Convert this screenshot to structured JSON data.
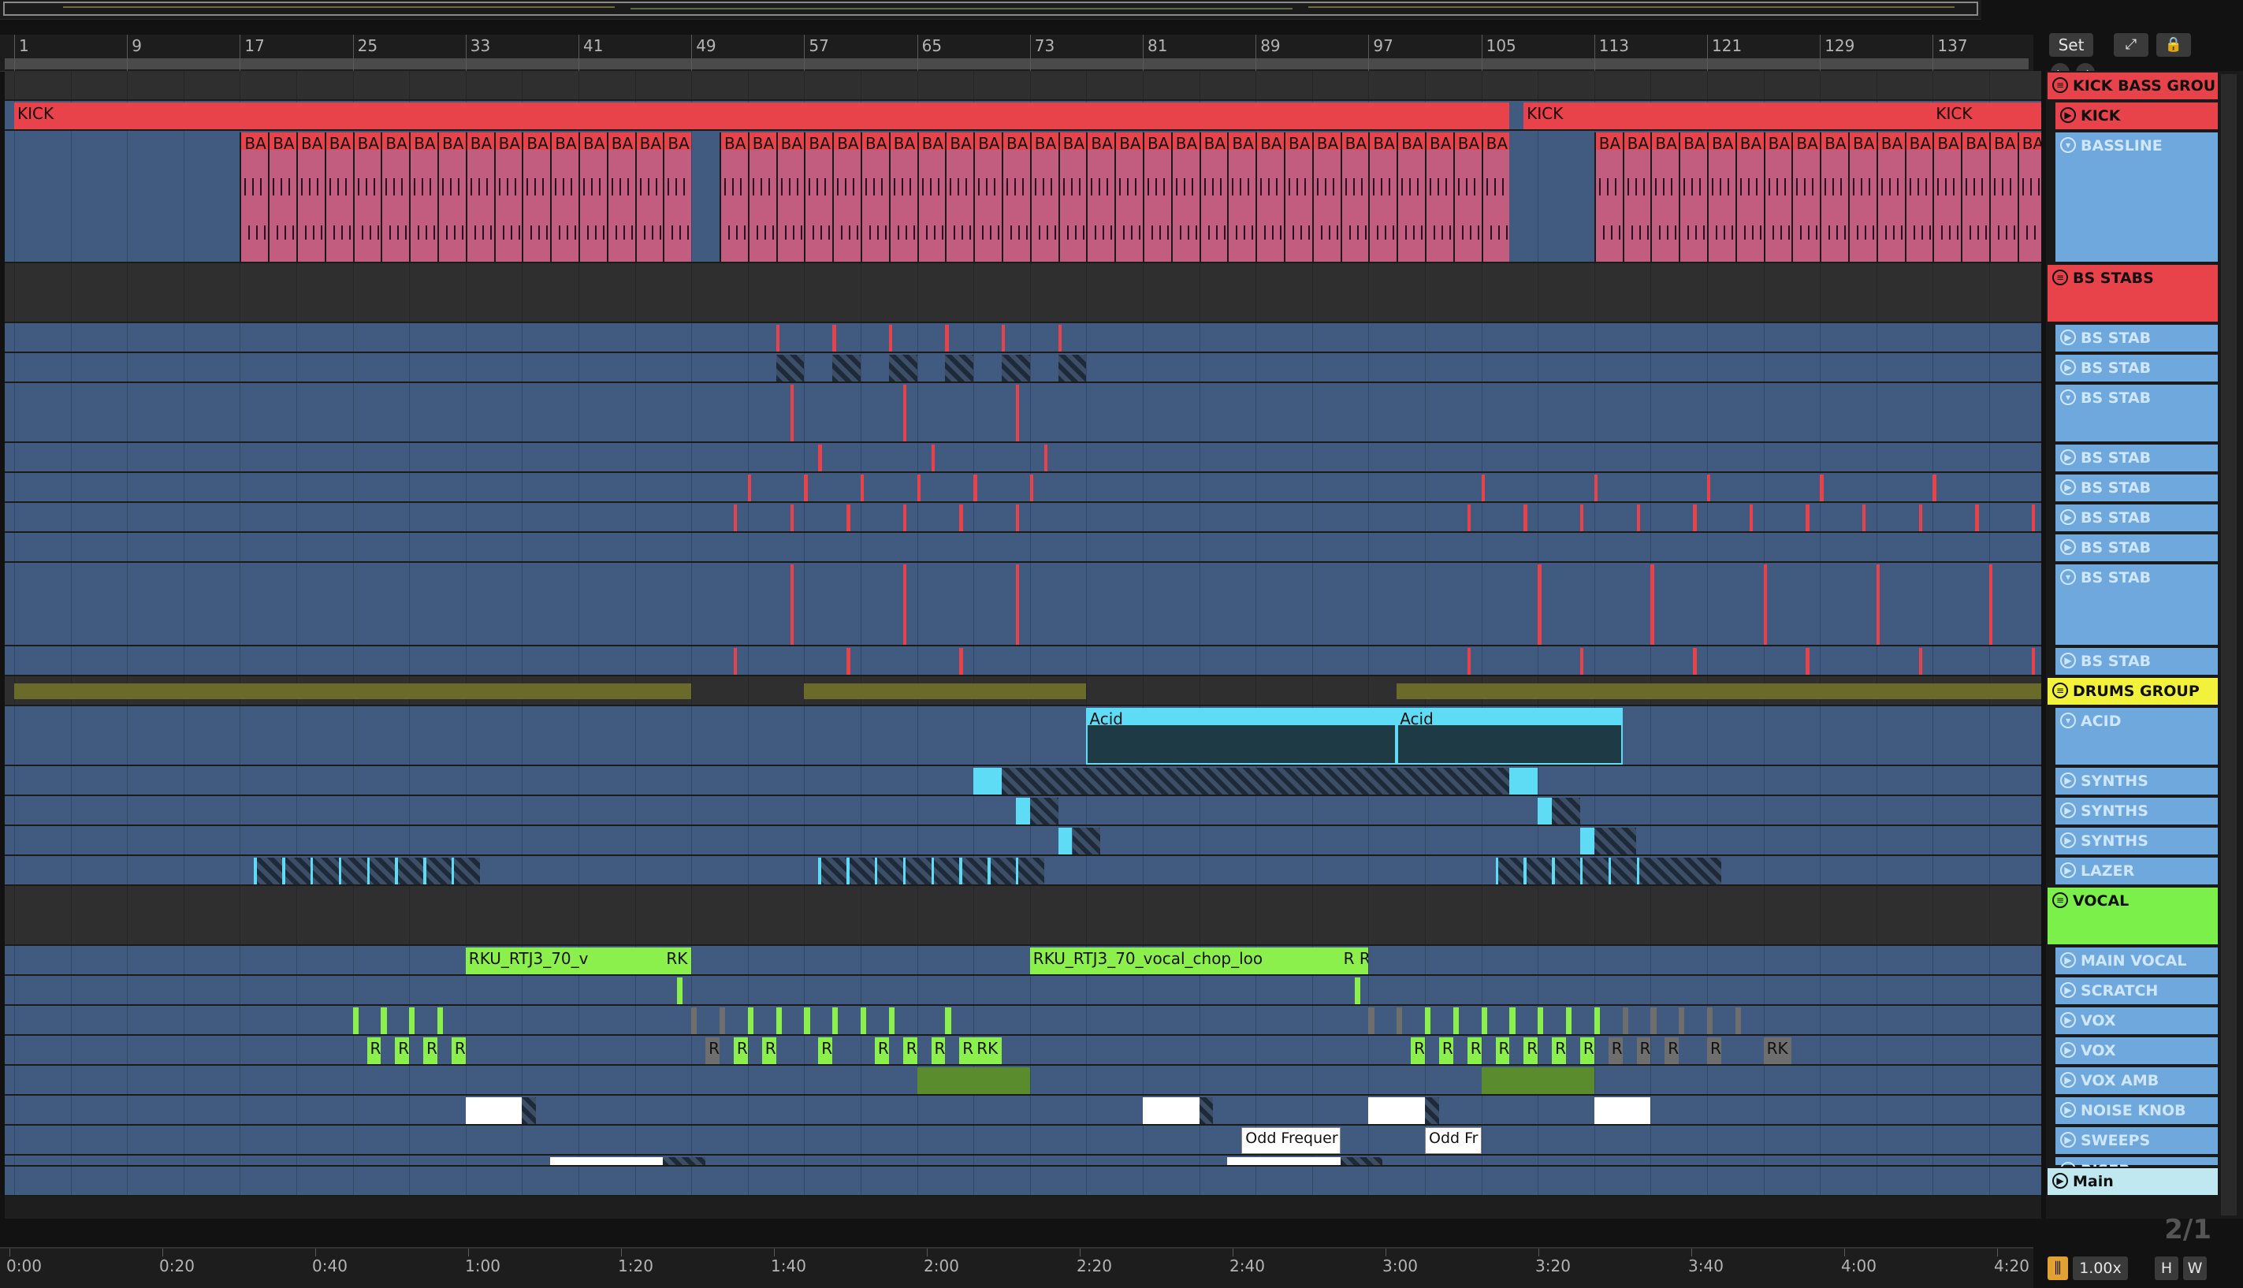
{
  "app": {
    "set_label": "Set",
    "zoom_label": "2/1"
  },
  "bar_ruler": [
    "1",
    "9",
    "17",
    "25",
    "33",
    "41",
    "49",
    "57",
    "65",
    "73",
    "81",
    "89",
    "97",
    "105",
    "113",
    "121",
    "129",
    "137"
  ],
  "time_ruler": [
    "0:00",
    "0:20",
    "0:40",
    "1:00",
    "1:20",
    "1:40",
    "2:00",
    "2:20",
    "2:40",
    "3:00",
    "3:20",
    "3:40",
    "4:00",
    "4:20"
  ],
  "tracks": [
    {
      "name": "KICK BASS GROU",
      "kind": "group",
      "color": "#e8434a",
      "text": "#111111",
      "icon": "group-icon"
    },
    {
      "name": "KICK",
      "kind": "audio",
      "color": "#e8434a",
      "text": "#111111",
      "icon": "play-icon"
    },
    {
      "name": "BASSLINE",
      "kind": "midi",
      "color": "#6fa8dc",
      "text": "#cfe6ff",
      "icon": "fold-icon"
    },
    {
      "name": "BS STABS",
      "kind": "group",
      "color": "#e8434a",
      "text": "#111111",
      "icon": "group-icon"
    },
    {
      "name": "BS STAB",
      "kind": "midi",
      "color": "#6fa8dc",
      "text": "#cfe6ff",
      "icon": "play-icon"
    },
    {
      "name": "BS STAB",
      "kind": "midi",
      "color": "#6fa8dc",
      "text": "#cfe6ff",
      "icon": "play-icon"
    },
    {
      "name": "BS STAB",
      "kind": "midi",
      "color": "#6fa8dc",
      "text": "#cfe6ff",
      "icon": "fold-icon"
    },
    {
      "name": "BS STAB",
      "kind": "midi",
      "color": "#6fa8dc",
      "text": "#cfe6ff",
      "icon": "play-icon"
    },
    {
      "name": "BS STAB",
      "kind": "midi",
      "color": "#6fa8dc",
      "text": "#cfe6ff",
      "icon": "play-icon"
    },
    {
      "name": "BS STAB",
      "kind": "midi",
      "color": "#6fa8dc",
      "text": "#cfe6ff",
      "icon": "play-icon"
    },
    {
      "name": "BS STAB",
      "kind": "midi",
      "color": "#6fa8dc",
      "text": "#cfe6ff",
      "icon": "play-icon"
    },
    {
      "name": "BS STAB",
      "kind": "midi",
      "color": "#6fa8dc",
      "text": "#cfe6ff",
      "icon": "fold-icon"
    },
    {
      "name": "BS STAB",
      "kind": "midi",
      "color": "#6fa8dc",
      "text": "#cfe6ff",
      "icon": "play-icon"
    },
    {
      "name": "DRUMS GROUP",
      "kind": "group",
      "color": "#f2f23a",
      "text": "#111111",
      "icon": "group-icon"
    },
    {
      "name": "ACID",
      "kind": "midi",
      "color": "#6fa8dc",
      "text": "#cfe6ff",
      "icon": "fold-icon"
    },
    {
      "name": "SYNTHS",
      "kind": "midi",
      "color": "#6fa8dc",
      "text": "#cfe6ff",
      "icon": "play-icon"
    },
    {
      "name": "SYNTHS",
      "kind": "midi",
      "color": "#6fa8dc",
      "text": "#cfe6ff",
      "icon": "play-icon"
    },
    {
      "name": "SYNTHS",
      "kind": "midi",
      "color": "#6fa8dc",
      "text": "#cfe6ff",
      "icon": "play-icon"
    },
    {
      "name": "LAZER",
      "kind": "midi",
      "color": "#6fa8dc",
      "text": "#cfe6ff",
      "icon": "play-icon"
    },
    {
      "name": "VOCAL",
      "kind": "group",
      "color": "#7cf04a",
      "text": "#111111",
      "icon": "group-icon"
    },
    {
      "name": "MAIN VOCAL",
      "kind": "audio",
      "color": "#6fa8dc",
      "text": "#cfe6ff",
      "icon": "play-icon"
    },
    {
      "name": "SCRATCH",
      "kind": "audio",
      "color": "#6fa8dc",
      "text": "#cfe6ff",
      "icon": "play-icon"
    },
    {
      "name": "VOX",
      "kind": "audio",
      "color": "#6fa8dc",
      "text": "#cfe6ff",
      "icon": "play-icon"
    },
    {
      "name": "VOX",
      "kind": "audio",
      "color": "#6fa8dc",
      "text": "#cfe6ff",
      "icon": "play-icon"
    },
    {
      "name": "VOX AMB",
      "kind": "audio",
      "color": "#6fa8dc",
      "text": "#cfe6ff",
      "icon": "play-icon"
    },
    {
      "name": "NOISE KNOB",
      "kind": "audio",
      "color": "#6fa8dc",
      "text": "#cfe6ff",
      "icon": "play-icon"
    },
    {
      "name": "SWEEPS",
      "kind": "audio",
      "color": "#6fa8dc",
      "text": "#cfe6ff",
      "icon": "play-icon"
    },
    {
      "name": "RISER",
      "kind": "audio",
      "color": "#6fa8dc",
      "text": "#cfe6ff",
      "icon": "play-icon"
    },
    {
      "name": "Main",
      "kind": "main",
      "color": "#bfe8f0",
      "text": "#111111",
      "icon": "play-icon"
    }
  ],
  "clips": {
    "kick": [
      "KICK",
      "KICK",
      "KICK",
      "KICK",
      "KICK"
    ],
    "bass": "BA",
    "acid": [
      "Acid",
      "Acid"
    ],
    "vocal": [
      "RKU_RTJ3_70_v",
      "RK",
      "RKU_RTJ3_70_vocal_chop_loo",
      "R R"
    ],
    "vox_r": "R",
    "vox_rk": "RK",
    "sweeps": [
      "Odd Frequer",
      "Odd Fr"
    ]
  },
  "footer": {
    "tempo_mult": "1.00x",
    "h_label": "H",
    "w_label": "W"
  },
  "colors": {
    "red": "#e8434a",
    "yellow": "#f2f23a",
    "green": "#7cf04a",
    "cyan": "#5fdcf5",
    "lane": "#405a80"
  }
}
